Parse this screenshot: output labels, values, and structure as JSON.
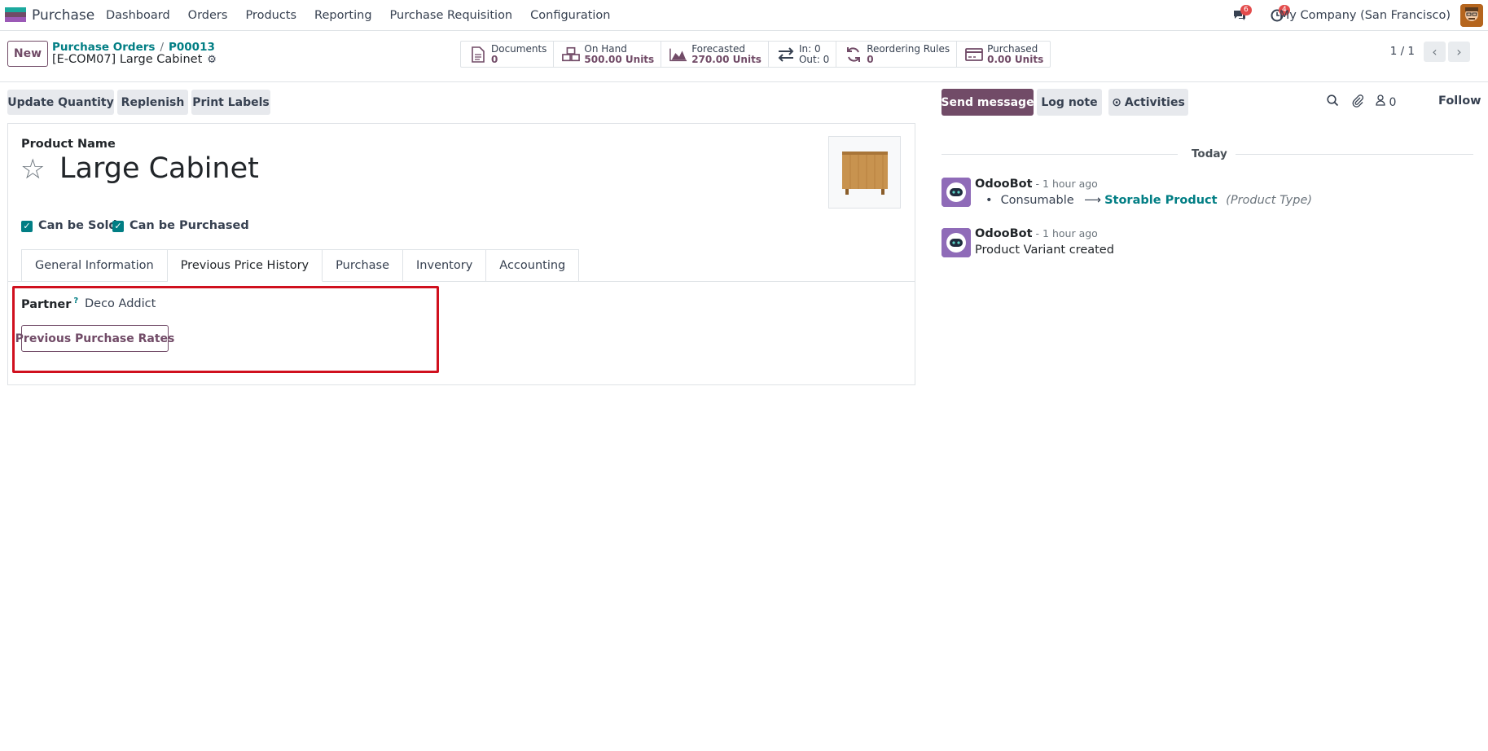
{
  "navbar": {
    "app_name": "Purchase",
    "menu": [
      "Dashboard",
      "Orders",
      "Products",
      "Reporting",
      "Purchase Requisition",
      "Configuration"
    ],
    "messages_badge": "6",
    "activities_badge": "4",
    "company": "My Company (San Francisco)"
  },
  "control_panel": {
    "new_label": "New",
    "breadcrumb": [
      "Purchase Orders",
      "P00013"
    ],
    "record_title": "[E-COM07] Large Cabinet",
    "smart_buttons": [
      {
        "icon": "file-icon",
        "line1": "Documents",
        "line2": "0"
      },
      {
        "icon": "cubes-icon",
        "line1": "On Hand",
        "line2": "500.00 Units"
      },
      {
        "icon": "area-chart-icon",
        "line1": "Forecasted",
        "line2": "270.00 Units"
      },
      {
        "icon": "exchange-icon",
        "line1": "In: 0",
        "line2": "Out: 0"
      },
      {
        "icon": "refresh-icon",
        "line1": "Reordering Rules",
        "line2": "0"
      },
      {
        "icon": "credit-card-icon",
        "line1": "Purchased",
        "line2": "0.00 Units"
      }
    ],
    "pager": "1 / 1"
  },
  "actions": [
    "Update Quantity",
    "Replenish",
    "Print Labels"
  ],
  "form": {
    "product_name_label": "Product Name",
    "product_name": "Large Cabinet",
    "can_be_sold": "Can be Sold",
    "can_be_purchased": "Can be Purchased",
    "tabs": [
      "General Information",
      "Previous Price History",
      "Purchase",
      "Inventory",
      "Accounting"
    ],
    "active_tab": "Previous Price History",
    "partner_label": "Partner",
    "partner_help": "?",
    "partner_value": "Deco Addict",
    "rates_button": "Previous Purchase Rates"
  },
  "chatter": {
    "send_message": "Send message",
    "log_note": "Log note",
    "activities": "Activities",
    "followers_count": "0",
    "follow": "Follow",
    "date_separator": "Today",
    "messages": [
      {
        "author": "OdooBot",
        "time": " - 1 hour ago",
        "old_value": "Consumable",
        "arrow": "⟶",
        "new_value": "Storable Product",
        "field": "(Product Type)"
      },
      {
        "author": "OdooBot",
        "time": " - 1 hour ago",
        "body": "Product Variant created"
      }
    ]
  },
  "colors": {
    "primary": "#714b67",
    "teal": "#017e84",
    "highlight_border": "#d0101e",
    "badge": "#e34b4b"
  }
}
